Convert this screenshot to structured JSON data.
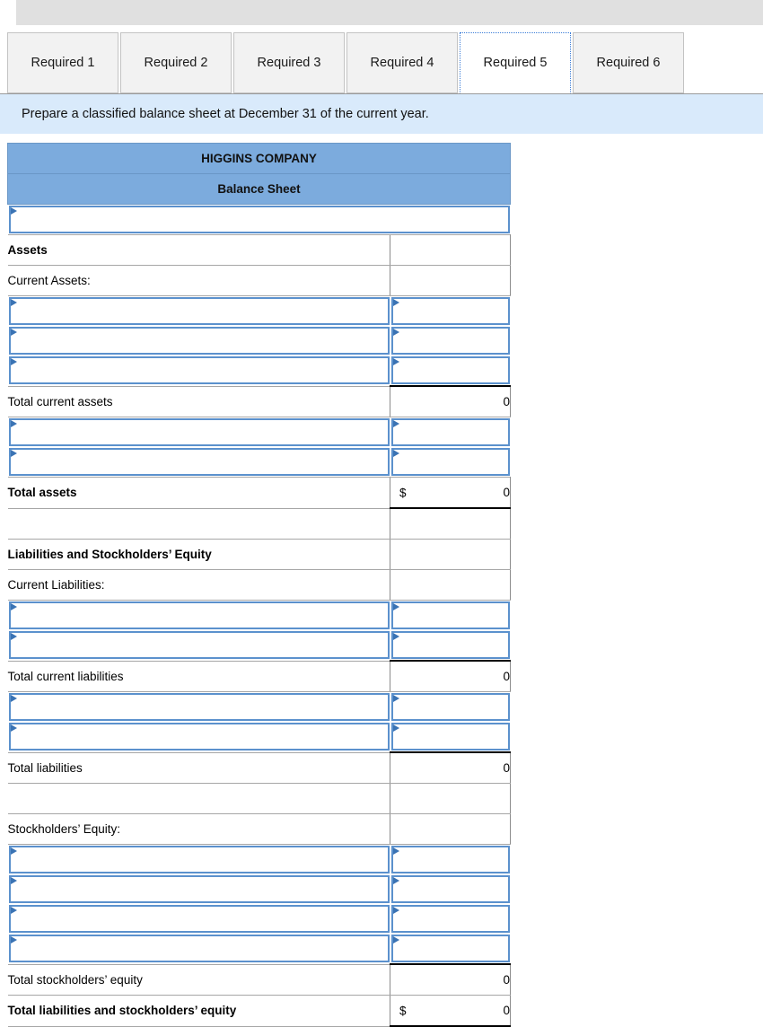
{
  "window": {
    "ghost_text": "· · · · · ·"
  },
  "tabs": {
    "items": [
      {
        "label": "Required 1",
        "active": false
      },
      {
        "label": "Required 2",
        "active": false
      },
      {
        "label": "Required 3",
        "active": false
      },
      {
        "label": "Required 4",
        "active": false
      },
      {
        "label": "Required 5",
        "active": true
      },
      {
        "label": "Required 6",
        "active": false
      }
    ]
  },
  "instruction": {
    "text": "Prepare a classified balance sheet at December 31 of the current year."
  },
  "sheet": {
    "company": "HIGGINS COMPANY",
    "statement": "Balance Sheet",
    "currency_symbol": "$",
    "labels": {
      "assets": "Assets",
      "current_assets": "Current Assets:",
      "total_current_assets": "Total current assets",
      "total_assets": "Total assets",
      "liabilities_and_equity": "Liabilities and Stockholders’ Equity",
      "current_liabilities": "Current Liabilities:",
      "total_current_liabilities": "Total current liabilities",
      "total_liabilities": "Total liabilities",
      "stockholders_equity": "Stockholders’ Equity:",
      "total_stockholders_equity": "Total stockholders’ equity",
      "total_liabilities_and_equity": "Total liabilities and stockholders’ equity"
    },
    "values": {
      "total_current_assets": "0",
      "total_assets": "0",
      "total_current_liabilities": "0",
      "total_liabilities": "0",
      "total_stockholders_equity": "0",
      "total_liabilities_and_equity": "0"
    }
  },
  "colors": {
    "band_blue": "#7cabdd",
    "banner_blue": "#d9eafb",
    "input_border": "#5b91cd",
    "marker_blue": "#3a73b4"
  }
}
